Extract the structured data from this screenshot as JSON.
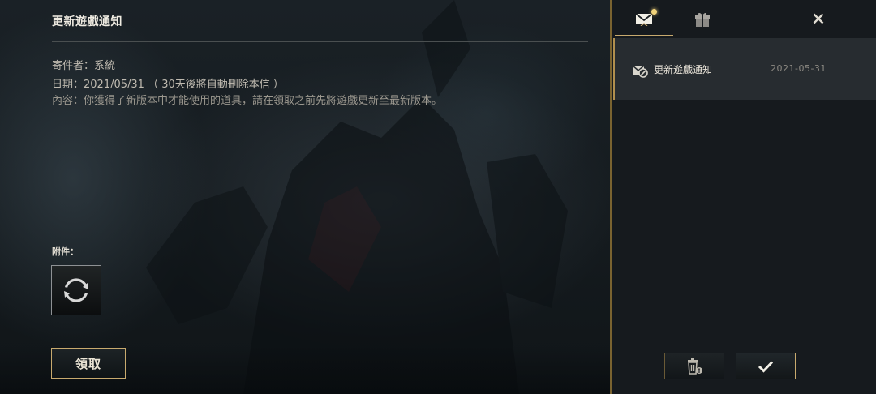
{
  "detail": {
    "title": "更新遊戲通知",
    "sender": "寄件者：系統",
    "date": "日期：2021/05/31 （ 30天後將自動刪除本信 ）",
    "content": "內容：你獲得了新版本中才能使用的道具，請在領取之前先將遊戲更新至最新版本。",
    "attachments_label": "附件：",
    "attachment_icon": "refresh-icon",
    "claim_label": "領取"
  },
  "inbox": {
    "tabs": [
      {
        "name": "mail",
        "icon": "mail-icon",
        "active": true,
        "unread": true
      },
      {
        "name": "gift",
        "icon": "gift-icon",
        "active": false
      }
    ],
    "close_icon": "close-icon",
    "items": [
      {
        "icon": "mail-open-icon",
        "title": "更新遊戲通知",
        "date": "2021-05-31",
        "selected": true
      }
    ],
    "delete_icon": "trash-icon",
    "confirm_icon": "checkmark-icon"
  },
  "colors": {
    "gold": "#c8aa6e",
    "unread": "#f0d27a",
    "panel": "#161a1e",
    "selected_item": "#272c30"
  }
}
